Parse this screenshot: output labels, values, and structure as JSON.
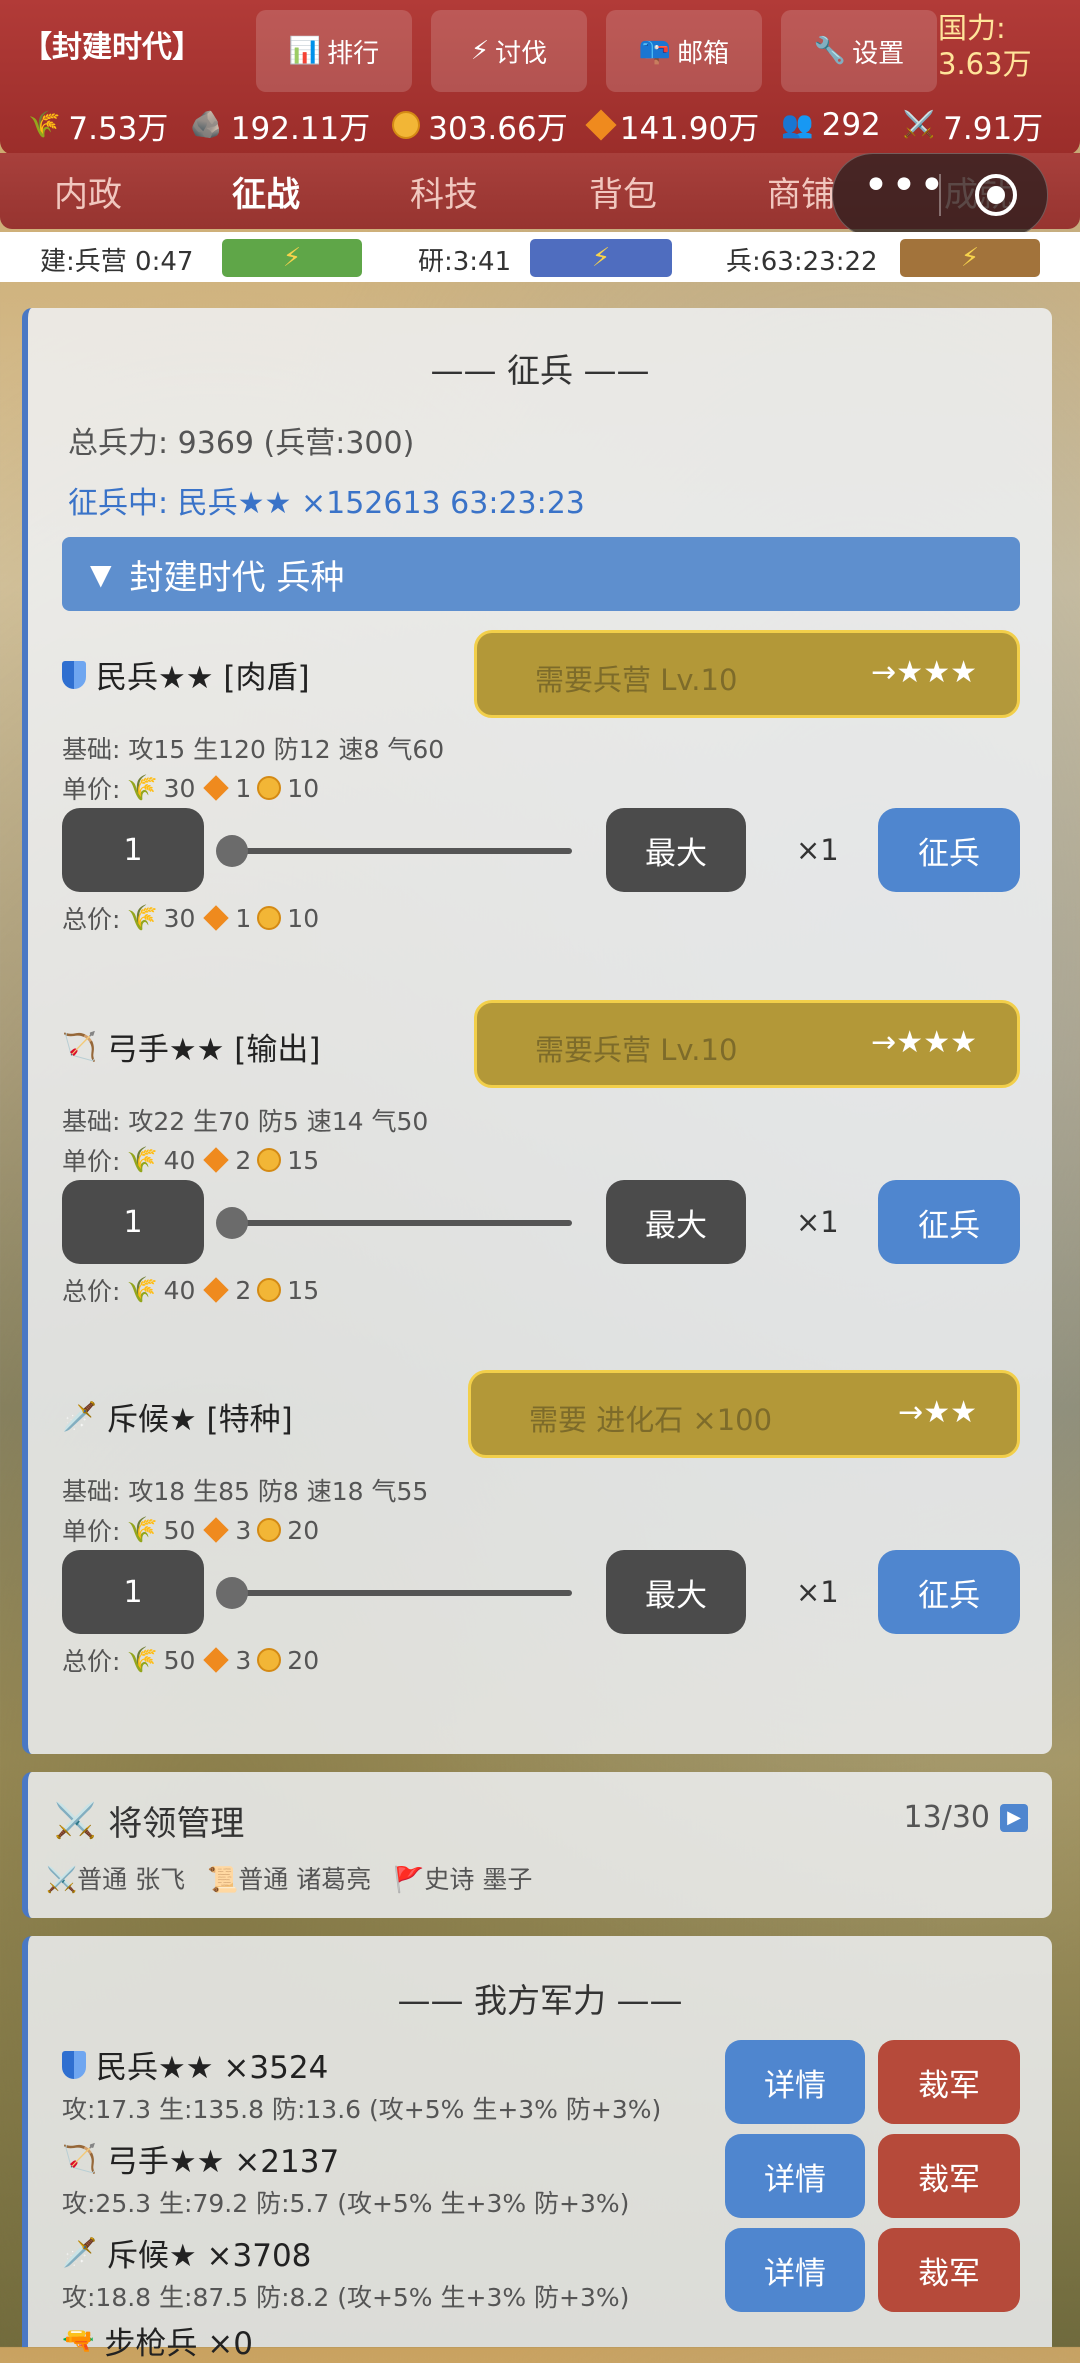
{
  "header": {
    "era": "【封建时代】",
    "buttons": [
      {
        "icon": "📊",
        "label": "排行"
      },
      {
        "icon": "⚡",
        "label": "讨伐"
      },
      {
        "icon": "📪",
        "label": "邮箱"
      },
      {
        "icon": "🔧",
        "label": "设置"
      }
    ],
    "power_label": "国力:",
    "power_value": "3.63万",
    "resources": {
      "grain": "7.53万",
      "stone": "192.11万",
      "gold": "303.66万",
      "gem": "141.90万",
      "population": "292",
      "army": "7.91万"
    }
  },
  "tabs": [
    "内政",
    "征战",
    "科技",
    "背包",
    "商铺",
    "成就"
  ],
  "active_tab": "征战",
  "queue": {
    "build_text": "建:兵营 0:47",
    "research_text": "研:3:41",
    "troop_text": "兵:63:23:22",
    "speedup": "⚡",
    "colors": {
      "build": "#5fa648",
      "research": "#4f6dbf",
      "troop": "#a2733b"
    }
  },
  "recruit": {
    "title": "—— 征兵 ——",
    "total_label": "总兵力: 9369 (兵营:300)",
    "in_progress": "征兵中: 民兵★★ ×152613 63:23:23",
    "category": "封建时代 兵种",
    "units": [
      {
        "name": "民兵★★ [肉盾]",
        "icon": "shield-icon",
        "requirement": "需要兵营 Lv.10",
        "upgrade": "→★★★",
        "base": "基础: 攻15 生120 防12 速8 气60",
        "unit_label": "单价:",
        "unit_grain": "30",
        "unit_gem": "1",
        "unit_gold": "10",
        "qty": "1",
        "max": "最大",
        "mult": "×1",
        "recruit": "征兵",
        "total_label": "总价:",
        "total_grain": "30",
        "total_gem": "1",
        "total_gold": "10"
      },
      {
        "name": "弓手★★ [输出]",
        "icon": "bow-icon",
        "requirement": "需要兵营 Lv.10",
        "upgrade": "→★★★",
        "base": "基础: 攻22 生70 防5 速14 气50",
        "unit_label": "单价:",
        "unit_grain": "40",
        "unit_gem": "2",
        "unit_gold": "15",
        "qty": "1",
        "max": "最大",
        "mult": "×1",
        "recruit": "征兵",
        "total_label": "总价:",
        "total_grain": "40",
        "total_gem": "2",
        "total_gold": "15"
      },
      {
        "name": "斥候★ [特种]",
        "icon": "dagger-icon",
        "requirement": "需要 进化石 ×100",
        "upgrade": "→★★",
        "base": "基础: 攻18 生85 防8 速18 气55",
        "unit_label": "单价:",
        "unit_grain": "50",
        "unit_gem": "3",
        "unit_gold": "20",
        "qty": "1",
        "max": "最大",
        "mult": "×1",
        "recruit": "征兵",
        "total_label": "总价:",
        "total_grain": "50",
        "total_gem": "3",
        "total_gold": "20"
      }
    ]
  },
  "generals": {
    "title": "将领管理",
    "count": "13/30",
    "list": [
      {
        "rank": "普通",
        "name": "张飞"
      },
      {
        "rank": "普通",
        "name": "诸葛亮"
      },
      {
        "rank": "史诗",
        "name": "墨子"
      }
    ]
  },
  "army": {
    "title": "—— 我方军力 ——",
    "units": [
      {
        "name": "民兵★★ ×3524",
        "stats": "攻:17.3 生:135.8 防:13.6 (攻+5% 生+3% 防+3%)",
        "detail": "详情",
        "cut": "裁军"
      },
      {
        "name": "弓手★★ ×2137",
        "stats": "攻:25.3 生:79.2 防:5.7 (攻+5% 生+3% 防+3%)",
        "detail": "详情",
        "cut": "裁军"
      },
      {
        "name": "斥候★ ×3708",
        "stats": "攻:18.8 生:87.5 防:8.2 (攻+5% 生+3% 防+3%)",
        "detail": "详情",
        "cut": "裁军"
      },
      {
        "name": "步枪兵 ×0"
      }
    ]
  }
}
